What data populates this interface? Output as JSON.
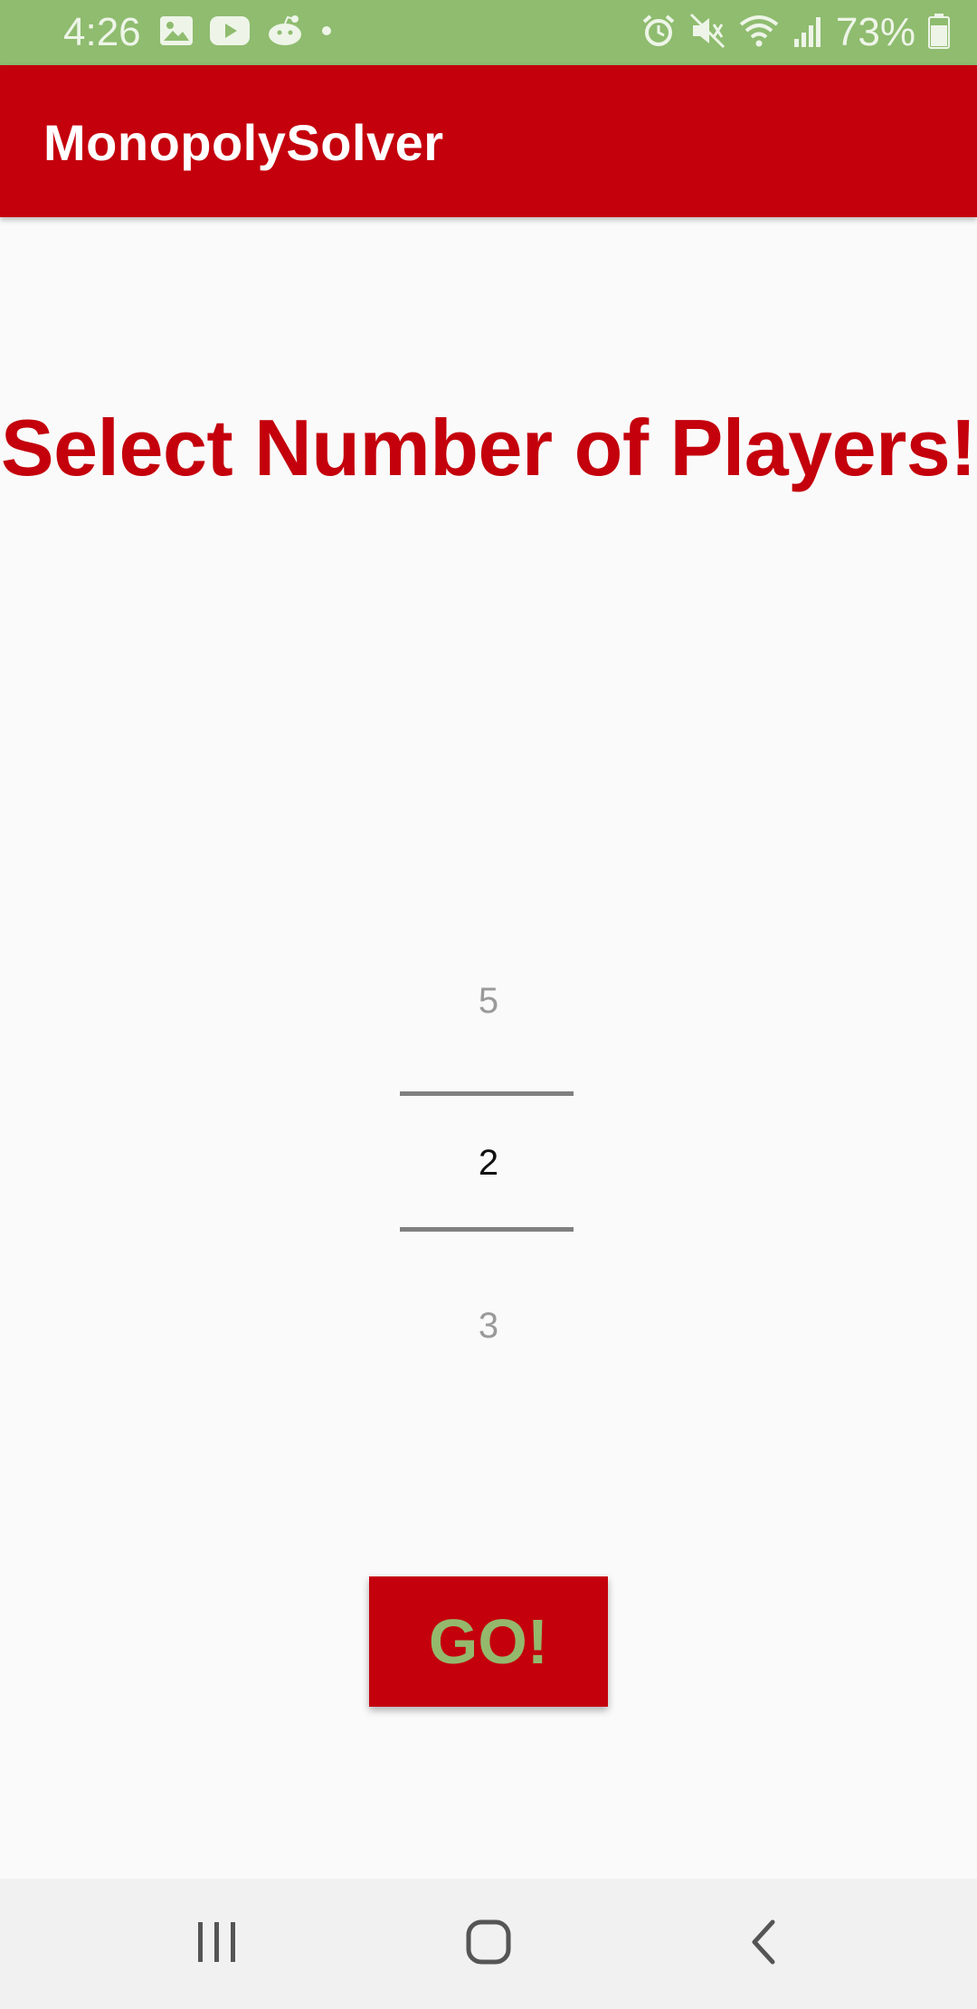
{
  "status_bar": {
    "time": "4:26",
    "battery": "73%",
    "left_icons": [
      "gallery-icon",
      "youtube-icon",
      "reddit-icon",
      "notification-dot-icon"
    ],
    "right_icons": [
      "alarm-icon",
      "mute-icon",
      "wifi-icon",
      "signal-icon",
      "battery-icon"
    ],
    "background_color": "#8fbc6f"
  },
  "app_bar": {
    "title": "MonopolySolver",
    "background_color": "#c4000c"
  },
  "main": {
    "heading": "Select Number of Players!",
    "player_picker": {
      "previous_value": "5",
      "selected_value": "2",
      "next_value": "3"
    },
    "go_button_label": "GO!",
    "go_button_text_color": "#94b96c"
  },
  "nav_bar": {
    "buttons": [
      "recent-apps-icon",
      "home-icon",
      "back-icon"
    ]
  }
}
